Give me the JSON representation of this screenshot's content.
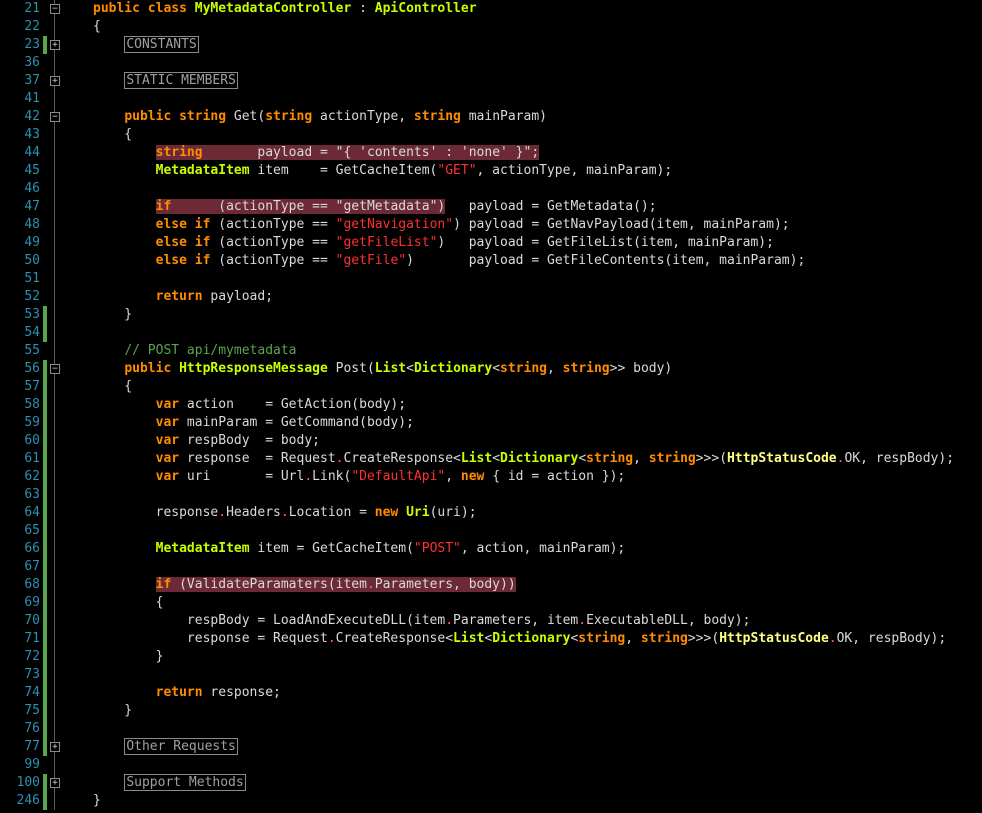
{
  "line_numbers": [
    "21",
    "22",
    "23",
    "36",
    "37",
    "41",
    "42",
    "43",
    "44",
    "45",
    "46",
    "47",
    "48",
    "49",
    "50",
    "51",
    "52",
    "53",
    "54",
    "55",
    "56",
    "57",
    "58",
    "59",
    "60",
    "61",
    "62",
    "63",
    "64",
    "65",
    "66",
    "67",
    "68",
    "69",
    "70",
    "71",
    "72",
    "73",
    "74",
    "75",
    "76",
    "77",
    "99",
    "100",
    "246"
  ],
  "regions": {
    "constants": "CONSTANTS",
    "static_members": "STATIC MEMBERS",
    "other_requests": "Other Requests",
    "support_methods": "Support Methods"
  },
  "strings": {
    "contents": "\"{ 'contents' : 'none' }\"",
    "get": "\"GET\"",
    "getMetadata": "\"getMetadata\"",
    "getNavigation": "\"getNavigation\"",
    "getFileList": "\"getFileList\"",
    "getFile": "\"getFile\"",
    "defaultApi": "\"DefaultApi\"",
    "post": "\"POST\""
  },
  "comment": "// POST api/mymetadata",
  "colors": {
    "background": "#000000",
    "line_numbers": "#2b91af",
    "keyword": "#ff8c00",
    "type": "#c8ff00",
    "string": "#ff3030",
    "comment": "#57a64a",
    "highlight": "#6b2a36",
    "change_marker": "#57a64a"
  }
}
